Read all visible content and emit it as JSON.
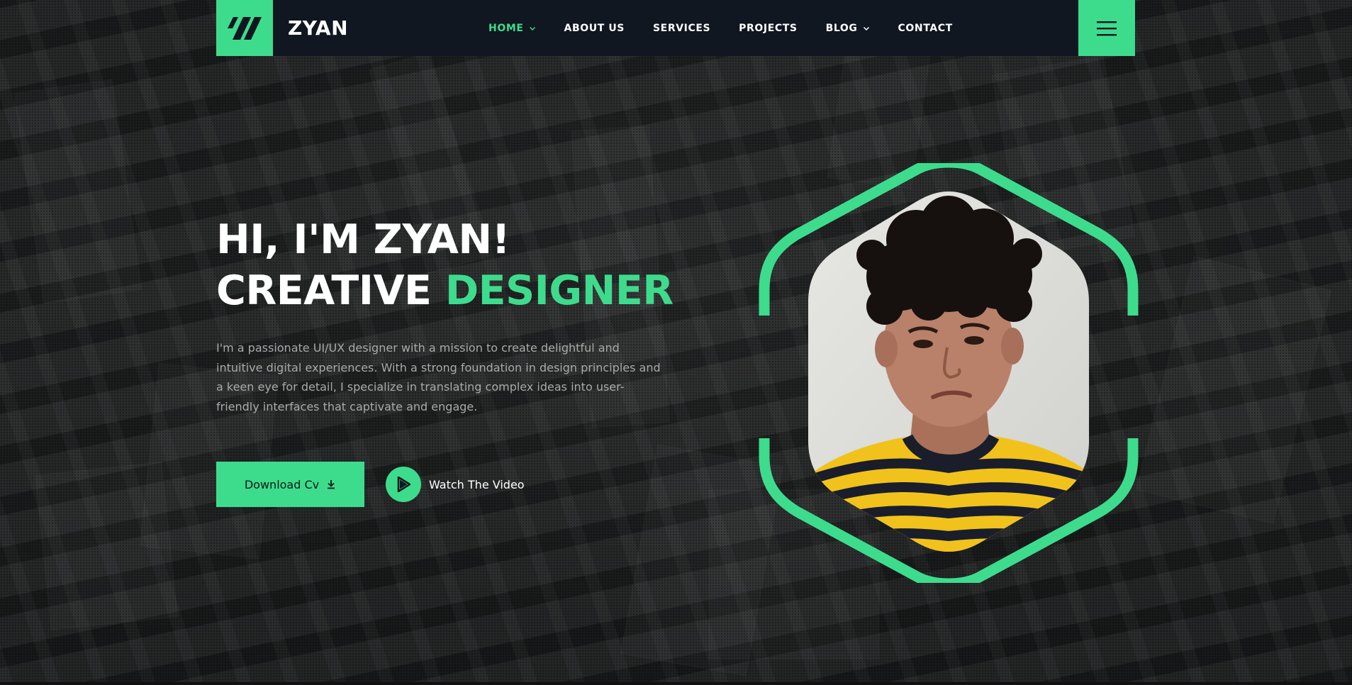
{
  "header": {
    "brand": "ZYAN",
    "logo_icon": "slash-stripes-logo-icon",
    "menu_icon": "hamburger-icon"
  },
  "nav": {
    "items": [
      {
        "label": "HOME",
        "active": true,
        "dropdown": true
      },
      {
        "label": "ABOUT US",
        "active": false,
        "dropdown": false
      },
      {
        "label": "SERVICES",
        "active": false,
        "dropdown": false
      },
      {
        "label": "PROJECTS",
        "active": false,
        "dropdown": false
      },
      {
        "label": "BLOG",
        "active": false,
        "dropdown": true
      },
      {
        "label": "CONTACT",
        "active": false,
        "dropdown": false
      }
    ]
  },
  "hero": {
    "line1": "HI, I'M ZYAN!",
    "line2_plain": "CREATIVE",
    "line2_accent": "DESIGNER",
    "description": "I'm a passionate UI/UX designer with a mission to create delightful and intuitive digital experiences. With a strong foundation in design principles and a keen eye for detail, I specialize in translating complex ideas into user-friendly interfaces that captivate and engage.",
    "cv_button": "Download Cv",
    "video_link": "Watch The Video"
  },
  "colors": {
    "accent": "#3ddc8d",
    "header_bg": "#101720",
    "text_muted": "#a8aaa8"
  }
}
